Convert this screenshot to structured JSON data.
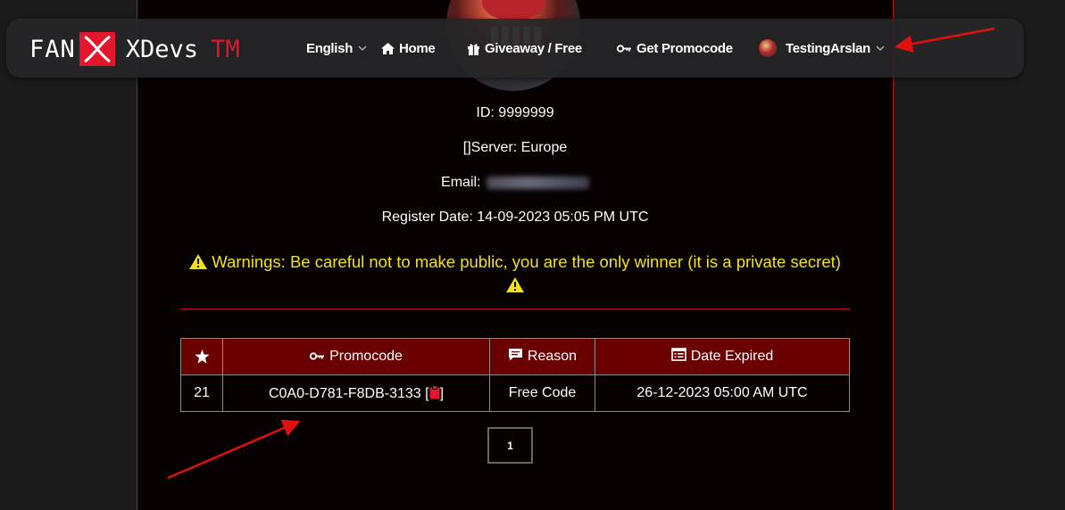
{
  "brand": {
    "part1": "FAN",
    "part2": "XDevs",
    "tm": "TM",
    "accent": "#e3162b"
  },
  "nav": {
    "language": "English",
    "home": "Home",
    "giveaway": "Giveaway / Free",
    "promocode": "Get Promocode",
    "user": "TestingArslan"
  },
  "profile": {
    "id_line": "ID: 9999999",
    "server_line": "[]Server: Europe",
    "email_label": "Email:",
    "register_line": "Register Date: 14-09-2023 05:05 PM UTC"
  },
  "warning": {
    "text": "Warnings: Be careful not to make public, you are the only winner (it is a private secret)",
    "color": "#f0e11a"
  },
  "table": {
    "headers": {
      "num": "",
      "promocode": "Promocode",
      "reason": "Reason",
      "date": "Date Expired"
    },
    "rows": [
      {
        "num": "21",
        "code": "C0A0-D781-F8DB-3133",
        "bracket_open": "[",
        "bracket_close": "]",
        "reason": "Free Code",
        "date": "26-12-2023 05:00 AM UTC"
      }
    ]
  },
  "pagination": {
    "current": "1"
  },
  "colors": {
    "header_bg": "#6b0000",
    "card_border": "#b3121c",
    "annotation_arrow": "#e01010"
  }
}
